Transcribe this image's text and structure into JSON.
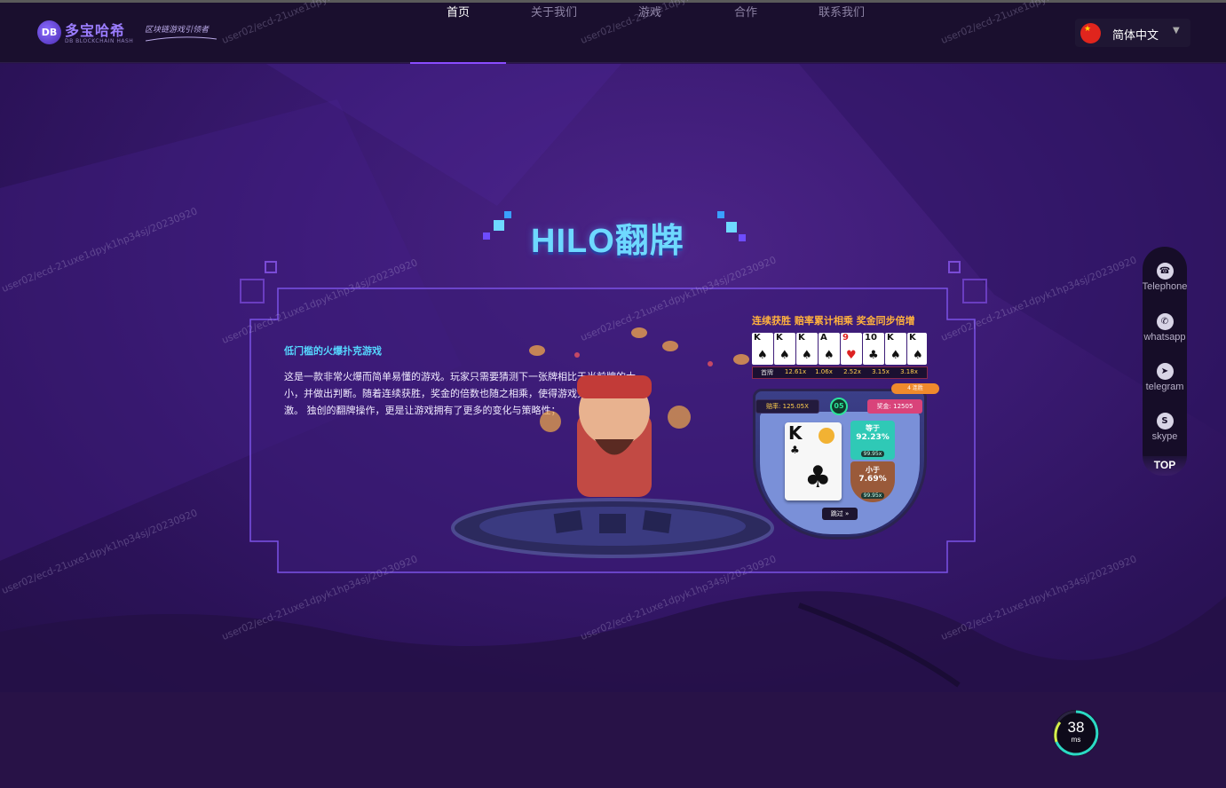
{
  "header": {
    "logo": {
      "badge": "DB",
      "name": "多宝哈希",
      "sub": "DB BLOCKCHAIN HASH",
      "slogan": "区块链游戏引领者"
    },
    "nav": [
      {
        "label": "首页",
        "active": true
      },
      {
        "label": "关于我们",
        "active": false
      },
      {
        "label": "游戏",
        "active": false
      },
      {
        "label": "合作",
        "active": false
      },
      {
        "label": "联系我们",
        "active": false
      }
    ],
    "language": {
      "label": "简体中文",
      "icon": "china-flag-icon"
    }
  },
  "hero": {
    "title": "HILO翻牌",
    "subtitle": "低门槛的火爆扑克游戏",
    "description": "这是一款非常火爆而简单易懂的游戏。玩家只需要猜测下一张牌相比于当前牌的大小，并做出判断。随着连续获胜，奖金的倍数也随之相乘，使得游戏充满挑战与刺激。 独创的翻牌操作，更是让游戏拥有了更多的变化与策略性；"
  },
  "game_mockup": {
    "heading": "连续获胜 赔率累计相乘 奖金同步倍增",
    "cards": [
      {
        "rank": "K",
        "suit": "♠"
      },
      {
        "rank": "K",
        "suit": "♠"
      },
      {
        "rank": "K",
        "suit": "♠"
      },
      {
        "rank": "A",
        "suit": "♠"
      },
      {
        "rank": "9",
        "suit": "♥"
      },
      {
        "rank": "10",
        "suit": "♣"
      },
      {
        "rank": "K",
        "suit": "♠"
      },
      {
        "rank": "K",
        "suit": "♠"
      }
    ],
    "multipliers": [
      "首牌",
      "12.61x",
      "1.06x",
      "2.52x",
      "3.15x",
      "3.18x"
    ],
    "odds": "赔率: 125.05X",
    "round": "05",
    "prize": "奖金: 12505",
    "streak": "4 连胜",
    "current_card": {
      "rank": "K",
      "suit": "♣"
    },
    "bet_up": {
      "name": "等于",
      "pct": "92.23%",
      "sub": "99.95x"
    },
    "bet_down": {
      "name": "小于",
      "pct": "7.69%",
      "sub": "99.95x"
    },
    "skip": "跳过 »"
  },
  "sidebar": {
    "items": [
      {
        "label": "Telephone",
        "icon": "phone-icon"
      },
      {
        "label": "whatsapp",
        "icon": "whatsapp-icon"
      },
      {
        "label": "telegram",
        "icon": "telegram-icon"
      },
      {
        "label": "skype",
        "icon": "skype-icon"
      }
    ],
    "top": "TOP"
  },
  "latency": {
    "value": "38",
    "unit": "ms"
  },
  "watermark": "user02/ecd-21uxe1dpyk1hp34sj/20230920",
  "colors": {
    "header_bg": "#1a0f2e",
    "hero_bg": "#3a1a72",
    "accent": "#8a4dff",
    "title": "#6ed9ff",
    "subtitle": "#55d7ff",
    "gold": "#ffb13d"
  }
}
